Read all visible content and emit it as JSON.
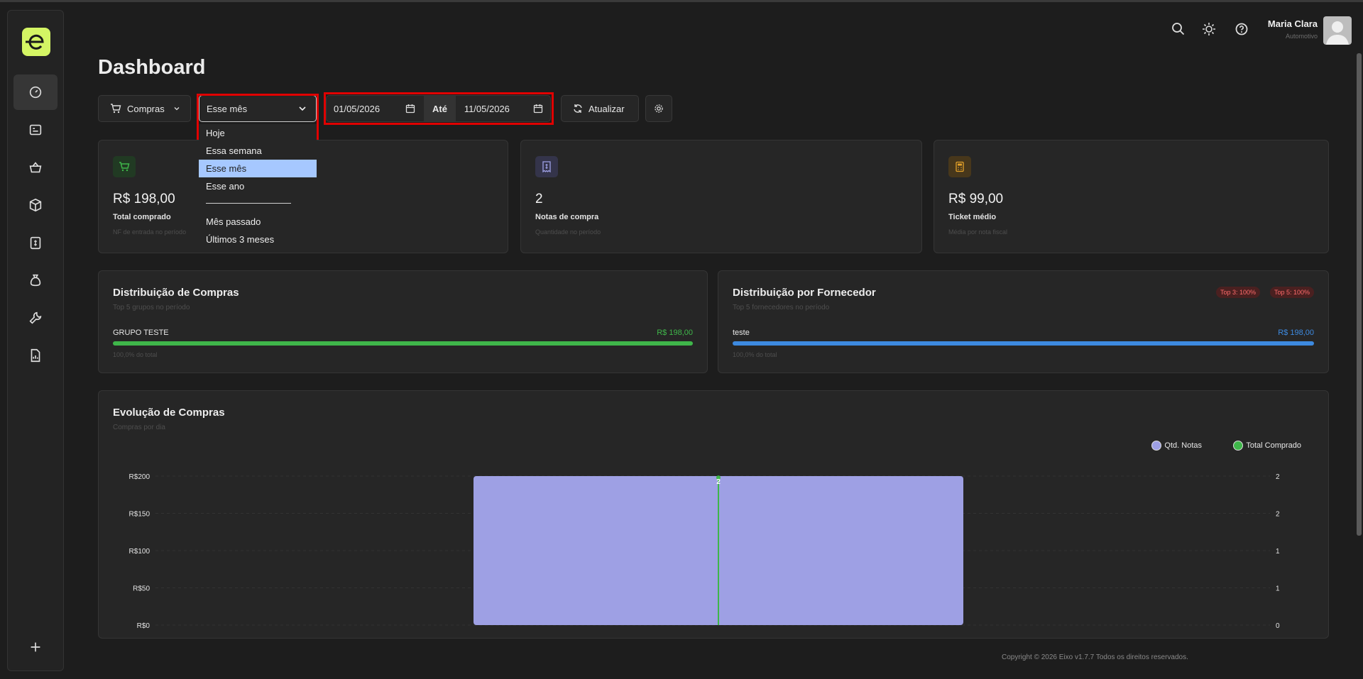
{
  "header": {
    "user_name": "Maria Clara",
    "user_role": "Automotivo"
  },
  "page_title": "Dashboard",
  "toolbar": {
    "type_select": "Compras",
    "period_select": "Esse mês",
    "date_from": "01/05/2026",
    "date_sep": "Até",
    "date_to": "11/05/2026",
    "refresh_label": "Atualizar"
  },
  "period_menu": {
    "items": [
      "Hoje",
      "Essa semana",
      "Esse mês",
      "Esse ano",
      "Mês passado",
      "Últimos 3 meses"
    ],
    "selected": "Esse mês"
  },
  "stats": [
    {
      "value": "R$ 198,00",
      "label": "Total comprado",
      "sub": "NF de entrada no período",
      "color": "#3fb64a"
    },
    {
      "value": "2",
      "label": "Notas de compra",
      "sub": "Quantidade no período",
      "color": "#8f8fd8"
    },
    {
      "value": "R$ 99,00",
      "label": "Ticket médio",
      "sub": "Média por nota fiscal",
      "color": "#e4a12a"
    }
  ],
  "dist_compras": {
    "title": "Distribuição de Compras",
    "sub": "Top 5 grupos no período",
    "label": "GRUPO TESTE",
    "value": "R$ 198,00",
    "pct": "100,0% do total",
    "color": "#3fb64a"
  },
  "dist_fornecedor": {
    "title": "Distribuição por Fornecedor",
    "sub": "Top 5 fornecedores no período",
    "badges": [
      "Top 3: 100%",
      "Top 5: 100%"
    ],
    "label": "teste",
    "value": "R$ 198,00",
    "pct": "100,0% do total",
    "color": "#3d8ae0"
  },
  "evolution": {
    "title": "Evolução de Compras",
    "sub": "Compras por dia"
  },
  "chart_data": {
    "type": "bar",
    "series": [
      {
        "name": "Qtd. Notas",
        "values": [
          2
        ],
        "color": "#9ea0e4",
        "axis": "right"
      },
      {
        "name": "Total Comprado",
        "values": [
          198
        ],
        "color": "#3fb64a",
        "axis": "left"
      }
    ],
    "left_ticks": [
      "R$200",
      "R$150",
      "R$100",
      "R$50",
      "R$0"
    ],
    "right_ticks": [
      "2",
      "2",
      "1",
      "1",
      "0"
    ],
    "bar_label": "2",
    "ylim_left": [
      0,
      200
    ],
    "ylim_right": [
      0,
      2
    ],
    "grid": true,
    "legend_position": "top-right"
  },
  "footer": "Copyright © 2026 Eixo v1.7.7 Todos os direitos reservados."
}
